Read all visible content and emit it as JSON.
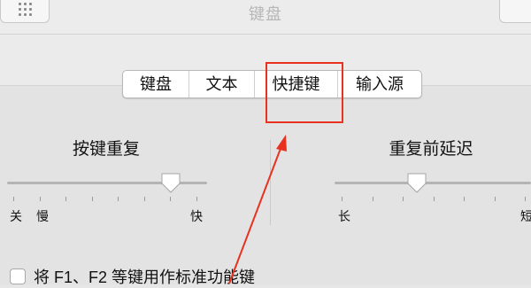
{
  "window": {
    "title": "键盘"
  },
  "tabs": [
    {
      "label": "键盘"
    },
    {
      "label": "文本"
    },
    {
      "label": "快捷键"
    },
    {
      "label": "输入源"
    }
  ],
  "key_repeat": {
    "title": "按键重复",
    "labels": {
      "off": "关",
      "slow": "慢",
      "fast": "快"
    },
    "value_fraction": 0.82
  },
  "repeat_delay": {
    "title": "重复前延迟",
    "labels": {
      "long": "长",
      "short": "短"
    },
    "value_fraction": 0.42
  },
  "fn_keys": {
    "checked": false,
    "label": "将 F1、F2 等键用作标准功能键"
  },
  "colors": {
    "annotation": "#e8321f"
  }
}
